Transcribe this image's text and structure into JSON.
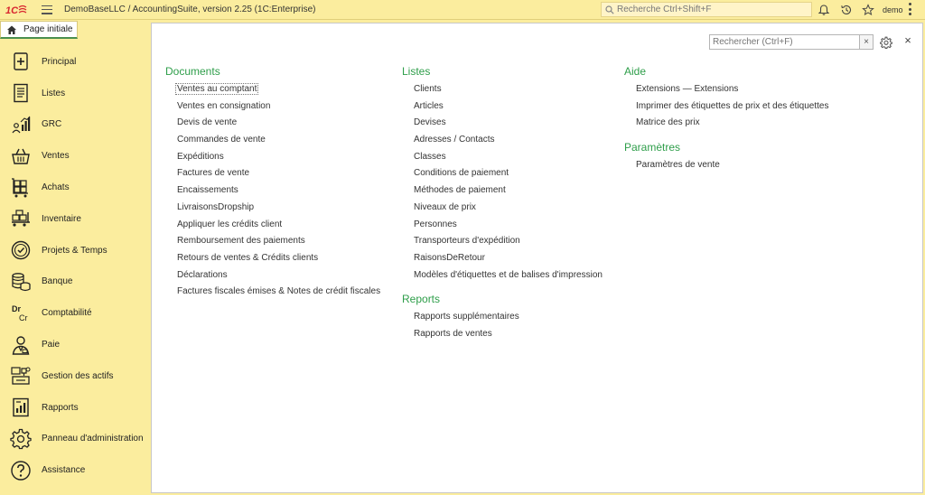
{
  "header": {
    "logo_text": "1Cε",
    "title": "DemoBaseLLC / AccountingSuite, version 2.25  (1C:Enterprise)",
    "search_placeholder": "Recherche Ctrl+Shift+F",
    "user": "demo",
    "icons": [
      "bell-icon",
      "history-icon",
      "star-icon",
      "more-icon"
    ]
  },
  "home_tab": {
    "label": "Page initiale",
    "icon": "home-icon"
  },
  "sidebar": {
    "items": [
      {
        "label": "Principal",
        "icon": "plus-box-icon"
      },
      {
        "label": "Listes",
        "icon": "list-document-icon"
      },
      {
        "label": "GRC",
        "icon": "people-chart-icon"
      },
      {
        "label": "Ventes",
        "icon": "basket-icon"
      },
      {
        "label": "Achats",
        "icon": "cart-boxes-icon"
      },
      {
        "label": "Inventaire",
        "icon": "forklift-boxes-icon"
      },
      {
        "label": "Projets & Temps",
        "icon": "clock-check-icon"
      },
      {
        "label": "Banque",
        "icon": "coins-stack-icon"
      },
      {
        "label": "Comptabilité",
        "icon": "dr-cr-icon",
        "icon_text_top": "Dr",
        "icon_text_bottom": "Cr"
      },
      {
        "label": "Paie",
        "icon": "employee-icon"
      },
      {
        "label": "Gestion des actifs",
        "icon": "assets-icon"
      },
      {
        "label": "Rapports",
        "icon": "report-chart-icon"
      },
      {
        "label": "Panneau d'administration",
        "icon": "gear-icon"
      },
      {
        "label": "Assistance",
        "icon": "question-circle-icon"
      }
    ]
  },
  "main": {
    "search_placeholder": "Rechercher (Ctrl+F)",
    "clear_label": "×",
    "close_label": "×",
    "documents": {
      "title": "Documents",
      "items": [
        "Ventes au comptant",
        "Ventes en consignation",
        "Devis de vente",
        "Commandes de vente",
        "Expéditions",
        "Factures de vente",
        "Encaissements",
        "LivraisonsDropship",
        "Appliquer les crédits client",
        "Remboursement des paiements",
        "Retours de ventes & Crédits clients",
        "Déclarations",
        "Factures fiscales émises & Notes de crédit fiscales"
      ]
    },
    "listes": {
      "title": "Listes",
      "items": [
        "Clients",
        "Articles",
        "Devises",
        "Adresses / Contacts",
        "Classes",
        "Conditions de paiement",
        "Méthodes de paiement",
        "Niveaux de prix",
        "Personnes",
        "Transporteurs d'expédition",
        "RaisonsDeRetour",
        "Modèles d'étiquettes et de balises d'impression"
      ]
    },
    "reports": {
      "title": "Reports",
      "items": [
        "Rapports supplémentaires",
        "Rapports de ventes"
      ]
    },
    "aide": {
      "title": "Aide",
      "items": [
        "Extensions — Extensions",
        "Imprimer des étiquettes de prix et des étiquettes",
        "Matrice des prix"
      ]
    },
    "parametres": {
      "title": "Paramètres",
      "items": [
        "Paramètres de vente"
      ]
    }
  },
  "colors": {
    "sidebar_bg": "#fbed9e",
    "section_title": "#2e9e4a",
    "accent_green": "#4a8f4e",
    "logo_red": "#d8262f"
  }
}
